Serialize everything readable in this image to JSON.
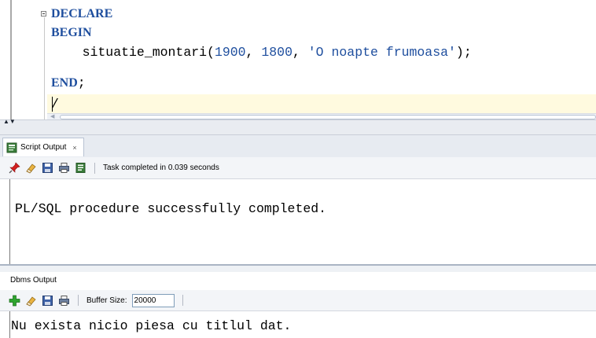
{
  "editor": {
    "lines": {
      "l1_kw": "DECLARE",
      "l2_kw": "BEGIN",
      "l3_name": "    situatie_montari(",
      "l3_arg1": "1900",
      "l3_sep1": ", ",
      "l3_arg2": "1800",
      "l3_sep2": ", ",
      "l3_arg3": "'O noapte frumoasa'",
      "l3_end": ");",
      "l4_kw": "END",
      "l4_end": ";",
      "l5": "/"
    }
  },
  "script_output": {
    "tab_label": "Script Output",
    "tab_close": "×",
    "toolbar_status": "Task completed in 0.039 seconds",
    "message": "PL/SQL procedure successfully completed."
  },
  "dbms_output": {
    "title": "Dbms Output",
    "buffer_label": "Buffer Size:",
    "buffer_value": "20000",
    "message": "Nu exista nicio piesa cu titlul dat."
  },
  "icons": {
    "pin": "pin-icon",
    "eraser": "eraser-icon",
    "save": "save-icon",
    "print": "print-icon",
    "export": "export-icon",
    "add": "add-icon"
  },
  "colors": {
    "keyword": "#1e4e9e",
    "current_line": "#fffadf",
    "tab_bar": "#e7ebf1"
  }
}
